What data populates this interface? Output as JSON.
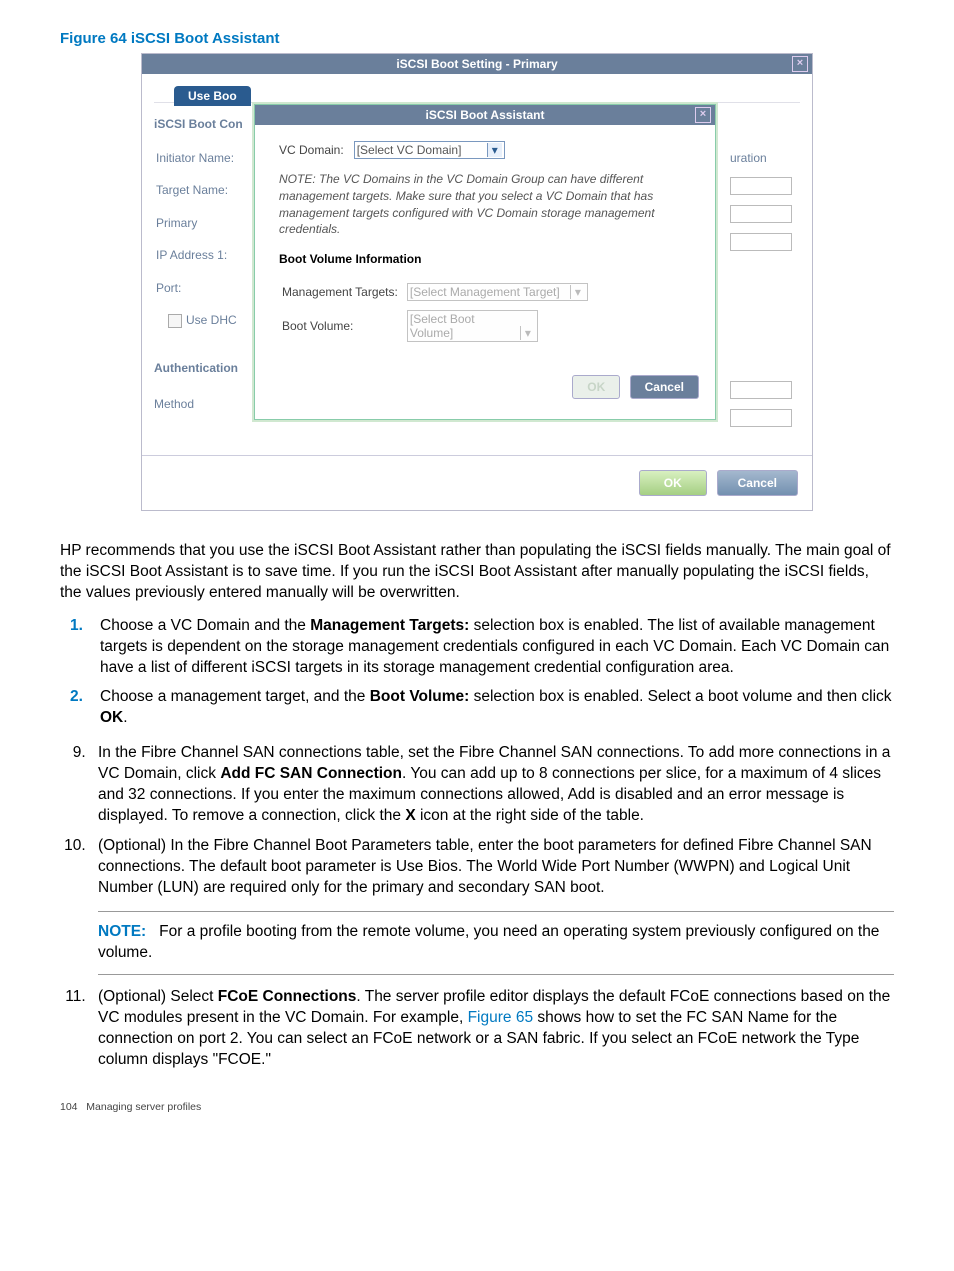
{
  "figure_caption": "Figure 64 iSCSI Boot Assistant",
  "outer_dialog": {
    "title": "iSCSI Boot Setting - Primary",
    "tab": "Use Boo",
    "side_heading1": "iSCSI Boot Con",
    "labels": {
      "initiator": "Initiator Name:",
      "target": "Target Name:",
      "primary": "Primary",
      "ip1": "IP Address 1:",
      "port": "Port:",
      "usedhc": "Use DHC"
    },
    "right_fragment": "uration",
    "side_heading2": "Authentication",
    "method": "Method",
    "ok": "OK",
    "cancel": "Cancel"
  },
  "inner_dialog": {
    "title": "iSCSI Boot Assistant",
    "vc_domain_label": "VC Domain:",
    "vc_domain_value": "[Select VC Domain]",
    "note": "NOTE: The VC Domains in the VC Domain Group can have different management targets. Make sure that you select a VC Domain that has management targets configured with VC Domain storage management credentials.",
    "section": "Boot Volume Information",
    "mgmt_label": "Management Targets:",
    "mgmt_value": "[Select Management Target]",
    "bootvol_label": "Boot Volume:",
    "bootvol_value": "[Select Boot Volume]",
    "ok": "OK",
    "cancel": "Cancel"
  },
  "paragraph_intro": "HP recommends that you use the iSCSI Boot Assistant rather than populating the iSCSI fields manually. The main goal of the iSCSI Boot Assistant is to save time. If you run the iSCSI Boot Assistant after manually populating the iSCSI fields, the values previously entered manually will be overwritten.",
  "sub1_a": "Choose a VC Domain and the ",
  "sub1_bold": "Management Targets:",
  "sub1_b": " selection box is enabled. The list of available management targets is dependent on the storage management credentials configured in each VC Domain. Each VC Domain can have a list of different iSCSI targets in its storage management credential configuration area.",
  "sub2_a": "Choose a management target, and the ",
  "sub2_bold": "Boot Volume:",
  "sub2_b": " selection box is enabled. Select a boot volume and then click ",
  "sub2_ok": "OK",
  "sub2_c": ".",
  "step9_a": "In the Fibre Channel SAN connections table, set the Fibre Channel SAN connections. To add more connections in a VC Domain, click ",
  "step9_bold": "Add FC SAN Connection",
  "step9_b": ". You can add up to 8 connections per slice, for a maximum of 4 slices and 32 connections. If you enter the maximum connections allowed, Add is disabled and an error message is displayed. To remove a connection, click the ",
  "step9_x": "X",
  "step9_c": " icon at the right side of the table.",
  "step10": "(Optional) In the Fibre Channel Boot Parameters table, enter the boot parameters for defined Fibre Channel SAN connections. The default boot parameter is Use Bios. The World Wide Port Number (WWPN) and Logical Unit Number (LUN) are required only for the primary and secondary SAN boot.",
  "note_label": "NOTE:",
  "note_text": "For a profile booting from the remote volume, you need an operating system previously configured on the volume.",
  "step11_a": "(Optional) Select ",
  "step11_bold": "FCoE Connections",
  "step11_b": ". The server profile editor displays the default FCoE connections based on the VC modules present in the VC Domain. For example, ",
  "step11_link": "Figure 65",
  "step11_c": " shows how to set the FC SAN Name for the connection on port 2. You can select an FCoE network or a SAN fabric. If you select an FCoE network the Type column displays \"FCOE.\"",
  "footer_page": "104",
  "footer_text": "Managing server profiles"
}
